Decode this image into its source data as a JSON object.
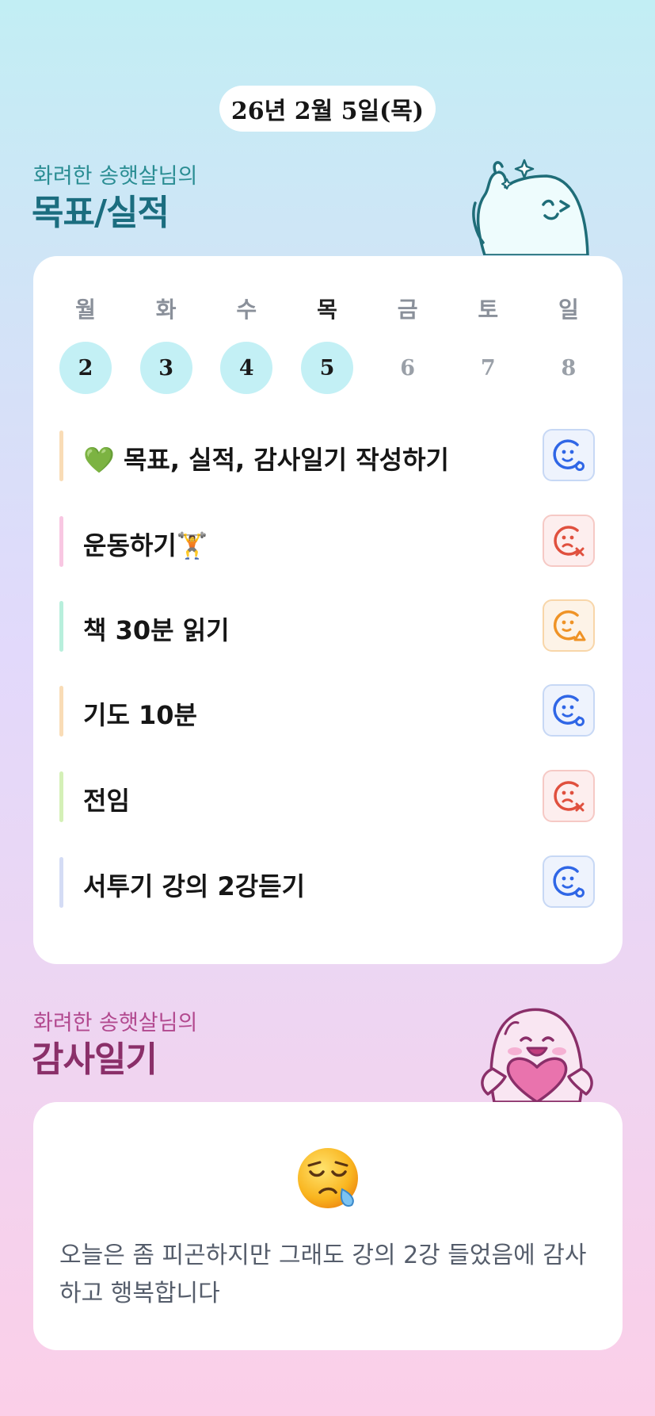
{
  "header": {
    "date": "26년 2월 5일(목)"
  },
  "goals_section": {
    "subtitle": "화려한 송햇살님의",
    "title": "목표/실적"
  },
  "week": {
    "days": [
      {
        "weekday": "월",
        "date": "2",
        "done": true,
        "active": false
      },
      {
        "weekday": "화",
        "date": "3",
        "done": true,
        "active": false
      },
      {
        "weekday": "수",
        "date": "4",
        "done": true,
        "active": false
      },
      {
        "weekday": "목",
        "date": "5",
        "done": true,
        "active": true
      },
      {
        "weekday": "금",
        "date": "6",
        "done": false,
        "active": false
      },
      {
        "weekday": "토",
        "date": "7",
        "done": false,
        "active": false
      },
      {
        "weekday": "일",
        "date": "8",
        "done": false,
        "active": false
      }
    ]
  },
  "goals": [
    {
      "text": "💚 목표, 실적, 감사일기 작성하기",
      "bar_color": "#f9dcb6",
      "status": "happy",
      "status_icon": "smile-circle-icon"
    },
    {
      "text": "운동하기🏋",
      "bar_color": "#f8c7e2",
      "status": "sad",
      "status_icon": "sad-x-icon"
    },
    {
      "text": "책 30분 읽기",
      "bar_color": "#b8efdc",
      "status": "meh",
      "status_icon": "smile-triangle-icon"
    },
    {
      "text": "기도 10분",
      "bar_color": "#f9dcb6",
      "status": "happy",
      "status_icon": "smile-circle-icon"
    },
    {
      "text": "전임",
      "bar_color": "#d4f0b7",
      "status": "sad",
      "status_icon": "sad-x-icon"
    },
    {
      "text": "서투기 강의 2강듣기",
      "bar_color": "#d4dcf5",
      "status": "happy",
      "status_icon": "smile-circle-icon"
    }
  ],
  "gratitude_section": {
    "subtitle": "화려한 송햇살님의",
    "title": "감사일기",
    "emoji": "😪",
    "text": "오늘은 좀 피곤하지만 그래도 강의 2강 들었음에 감사하고 행복합니다"
  },
  "colors": {
    "happy": "#2f66e6",
    "sad": "#e0503e",
    "meh": "#ef9326",
    "day_done": "#c3f0f5",
    "goal_title": "#1b6d7f",
    "gratitude_title": "#8a2f69"
  }
}
